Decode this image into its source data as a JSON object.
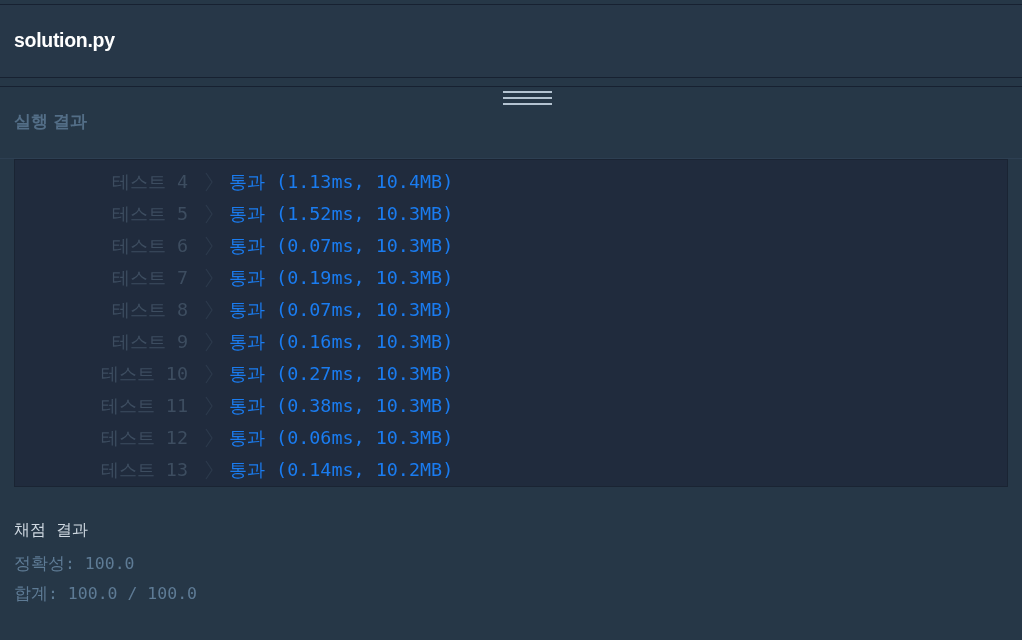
{
  "file_tab": {
    "title": "solution.py"
  },
  "result_panel": {
    "title": "실행 결과",
    "tests": [
      {
        "label": "테스트 4",
        "result": "통과 (1.13ms, 10.4MB)"
      },
      {
        "label": "테스트 5",
        "result": "통과 (1.52ms, 10.3MB)"
      },
      {
        "label": "테스트 6",
        "result": "통과 (0.07ms, 10.3MB)"
      },
      {
        "label": "테스트 7",
        "result": "통과 (0.19ms, 10.3MB)"
      },
      {
        "label": "테스트 8",
        "result": "통과 (0.07ms, 10.3MB)"
      },
      {
        "label": "테스트 9",
        "result": "통과 (0.16ms, 10.3MB)"
      },
      {
        "label": "테스트 10",
        "result": "통과 (0.27ms, 10.3MB)"
      },
      {
        "label": "테스트 11",
        "result": "통과 (0.38ms, 10.3MB)"
      },
      {
        "label": "테스트 12",
        "result": "통과 (0.06ms, 10.3MB)"
      },
      {
        "label": "테스트 13",
        "result": "통과 (0.14ms, 10.2MB)"
      }
    ]
  },
  "grading": {
    "title": "채점 결과",
    "lines": [
      "정확성: 100.0",
      "합계: 100.0 / 100.0"
    ]
  }
}
